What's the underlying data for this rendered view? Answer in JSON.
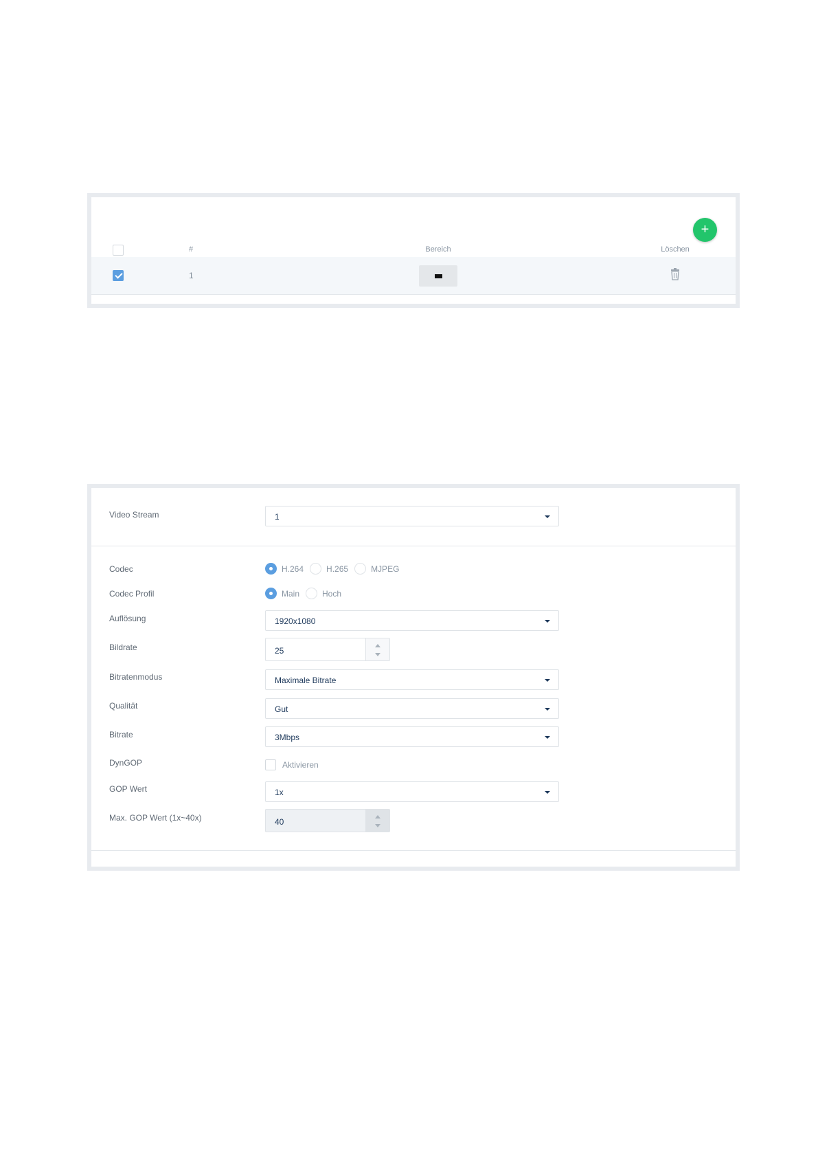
{
  "area_table": {
    "headers": {
      "number": "#",
      "area": "Bereich",
      "delete": "Löschen"
    },
    "add_label": "+",
    "rows": [
      {
        "number": "1",
        "checked": true
      }
    ]
  },
  "stream_form": {
    "video_stream": {
      "label": "Video Stream",
      "value": "1"
    },
    "codec": {
      "label": "Codec",
      "options": [
        "H.264",
        "H.265",
        "MJPEG"
      ],
      "selected": "H.264"
    },
    "codec_profile": {
      "label": "Codec Profil",
      "options": [
        "Main",
        "Hoch"
      ],
      "selected": "Main"
    },
    "resolution": {
      "label": "Auflösung",
      "value": "1920x1080"
    },
    "frame_rate": {
      "label": "Bildrate",
      "value": "25"
    },
    "bitrate_mode": {
      "label": "Bitratenmodus",
      "value": "Maximale Bitrate"
    },
    "quality": {
      "label": "Qualität",
      "value": "Gut"
    },
    "bitrate": {
      "label": "Bitrate",
      "value": "3Mbps"
    },
    "dyngop": {
      "label": "DynGOP",
      "checkbox_label": "Aktivieren",
      "checked": false
    },
    "gop_value": {
      "label": "GOP Wert",
      "value": "1x"
    },
    "max_gop": {
      "label": "Max. GOP Wert (1x~40x)",
      "value": "40"
    }
  },
  "colors": {
    "accent": "#5b9ee0",
    "add_button": "#22c56b"
  }
}
